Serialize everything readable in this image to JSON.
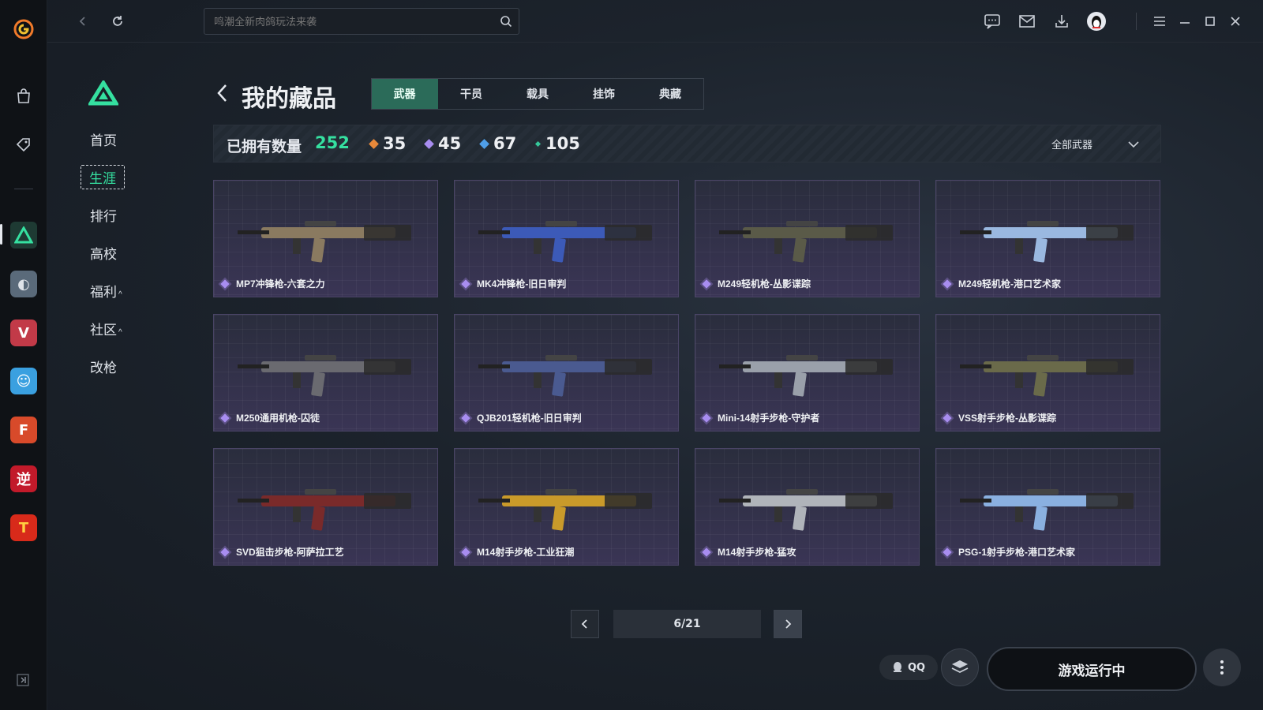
{
  "search": {
    "placeholder": "鸣潮全新肉鸽玩法来袭"
  },
  "sidebar_nav": {
    "items": [
      {
        "label": "首页"
      },
      {
        "label": "生涯",
        "active": true
      },
      {
        "label": "排行"
      },
      {
        "label": "高校"
      },
      {
        "label": "福利",
        "caret": "^"
      },
      {
        "label": "社区",
        "caret": "^"
      },
      {
        "label": "改枪"
      }
    ]
  },
  "page": {
    "title": "我的藏品",
    "tabs": [
      {
        "label": "武器",
        "active": true
      },
      {
        "label": "干员"
      },
      {
        "label": "载具"
      },
      {
        "label": "挂饰"
      },
      {
        "label": "典藏"
      }
    ]
  },
  "stats": {
    "owned_label": "已拥有数量",
    "owned_total": "252",
    "rarities": [
      {
        "value": "35",
        "color": "#e8893a"
      },
      {
        "value": "45",
        "color": "#a88df0"
      },
      {
        "value": "67",
        "color": "#4f9ee8"
      },
      {
        "value": "105",
        "color": "#35c79a"
      }
    ],
    "filter_label": "全部武器"
  },
  "items": [
    {
      "name": "MP7冲锋枪-六套之力",
      "color": "#8a7a60"
    },
    {
      "name": "MK4冲锋枪-旧日审判",
      "color": "#3c5ab8"
    },
    {
      "name": "M249轻机枪-丛影谍踪",
      "color": "#5a5a48"
    },
    {
      "name": "M249轻机枪-港口艺术家",
      "color": "#9ab8e0"
    },
    {
      "name": "M250通用机枪-囚徒",
      "color": "#6a6a70"
    },
    {
      "name": "QJB201轻机枪-旧日审判",
      "color": "#4a5a90"
    },
    {
      "name": "Mini-14射手步枪-守护者",
      "color": "#9aa0aa"
    },
    {
      "name": "VSS射手步枪-丛影谍踪",
      "color": "#6a6a4a"
    },
    {
      "name": "SVD狙击步枪-阿萨拉工艺",
      "color": "#7a2a2a"
    },
    {
      "name": "M14射手步枪-工业狂潮",
      "color": "#c99a2a"
    },
    {
      "name": "M14射手步枪-猛攻",
      "color": "#b0b4ba"
    },
    {
      "name": "PSG-1射手步枪-港口艺术家",
      "color": "#8ab0e0"
    }
  ],
  "pager": {
    "label": "6/21"
  },
  "bottom": {
    "qq_label": "QQ",
    "run_label": "游戏运行中"
  }
}
